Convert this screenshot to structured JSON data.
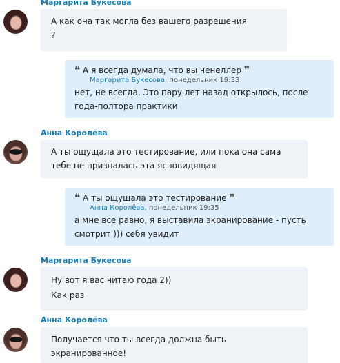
{
  "messages": [
    {
      "sender": "Маргарита Букесова",
      "lines": [
        "А как она так могла без вашего разрешения",
        "?"
      ]
    },
    {
      "quote": {
        "text": "А я всегда думала, что вы ченеллер",
        "author": "Маргарита Букесова",
        "timestamp": ", понедельник 19:33"
      },
      "lines": [
        "нет, не всегда. Это пару лет назад открылось, после",
        "года-полтора практики"
      ]
    },
    {
      "sender": "Анна Королёва",
      "lines": [
        "А ты ощущала это тестирование, или пока она сама",
        "тебе не призналась эта ясновидящая"
      ]
    },
    {
      "quote": {
        "text": "А ты ощущала это тестирование",
        "author": "Анна Королёва",
        "timestamp": ", понедельник 19:35"
      },
      "lines": [
        "а мне все равно, я выставила экранирование - пусть",
        "смотрит ))) себя увидит"
      ]
    },
    {
      "sender": "Маргарита Букесова",
      "lines": [
        "Ну вот я вас читаю года 2))",
        "Как раз"
      ]
    },
    {
      "sender": "Анна Королёва",
      "lines": [
        "Получается что ты всегда должна быть",
        "экранированное!"
      ]
    }
  ],
  "quote_open": "❝",
  "quote_close": "❞",
  "icons": {
    "avatar1": "user-avatar-icon",
    "avatar2": "user-avatar-icon"
  },
  "colors": {
    "sender": "#1a7fb5",
    "bubble": "#eef3f7",
    "quote_bubble": "#dfeefb"
  }
}
